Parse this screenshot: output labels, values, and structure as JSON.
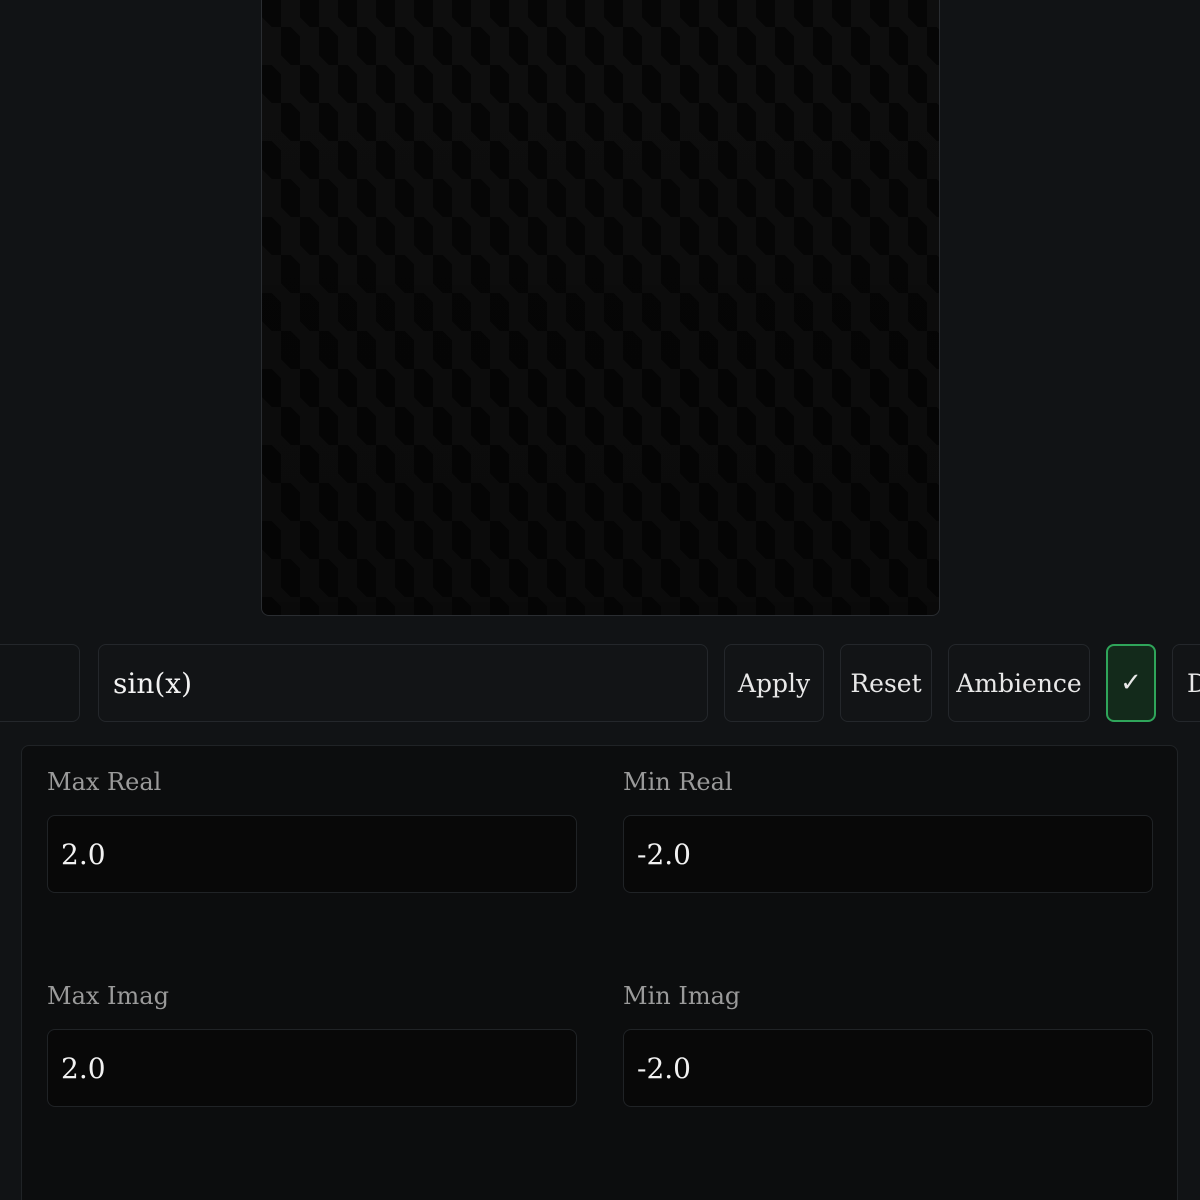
{
  "canvas": {
    "pattern": "checkerboard"
  },
  "toolbar": {
    "expression_value": "sin(x)",
    "apply_label": "Apply",
    "reset_label": "Reset",
    "ambience_label": "Ambience",
    "check_label": "✓",
    "cut_label": "D"
  },
  "ranges": {
    "max_real_label": "Max Real",
    "max_real_value": "2.0",
    "min_real_label": "Min Real",
    "min_real_value": "-2.0",
    "max_imag_label": "Max Imag",
    "max_imag_value": "2.0",
    "min_imag_label": "Min Imag",
    "min_imag_value": "-2.0"
  },
  "colors": {
    "background": "#111315",
    "accent_green": "#2fa55a"
  }
}
